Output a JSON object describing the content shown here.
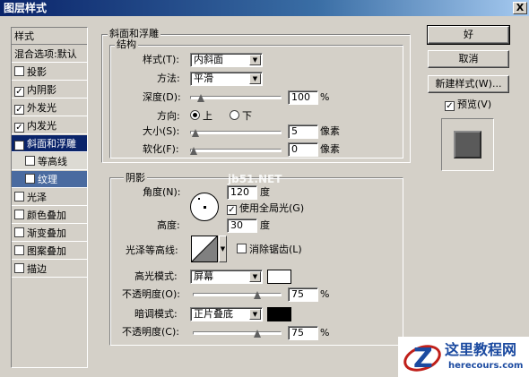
{
  "window": {
    "title": "图层样式",
    "close": "X"
  },
  "left_panel": {
    "items": [
      {
        "label": "样式",
        "checkbox": false
      },
      {
        "label": "混合选项:默认",
        "checkbox": false
      },
      {
        "label": "投影",
        "checkbox": true,
        "checked": false
      },
      {
        "label": "内阴影",
        "checkbox": true,
        "checked": true
      },
      {
        "label": "外发光",
        "checkbox": true,
        "checked": true
      },
      {
        "label": "内发光",
        "checkbox": true,
        "checked": true
      },
      {
        "label": "斜面和浮雕",
        "checkbox": true,
        "checked": true,
        "selected": true
      },
      {
        "label": "等高线",
        "checkbox": true,
        "checked": false,
        "sub": true
      },
      {
        "label": "纹理",
        "checkbox": true,
        "checked": false,
        "sub": true,
        "subsel": true
      },
      {
        "label": "光泽",
        "checkbox": true,
        "checked": false
      },
      {
        "label": "颜色叠加",
        "checkbox": true,
        "checked": false
      },
      {
        "label": "渐变叠加",
        "checkbox": true,
        "checked": false
      },
      {
        "label": "图案叠加",
        "checkbox": true,
        "checked": false
      },
      {
        "label": "描边",
        "checkbox": true,
        "checked": false
      }
    ]
  },
  "bevel": {
    "group_title": "斜面和浮雕",
    "structure_title": "结构",
    "style_label": "样式(T):",
    "style_value": "内斜面",
    "technique_label": "方法:",
    "technique_value": "平滑",
    "depth_label": "深度(D):",
    "depth_value": "100",
    "depth_unit": "%",
    "depth_level": 0.08,
    "direction_label": "方向:",
    "direction_up": "上",
    "direction_down": "下",
    "size_label": "大小(S):",
    "size_value": "5",
    "size_unit": "像素",
    "size_level": 0.02,
    "soften_label": "软化(F):",
    "soften_value": "0",
    "soften_unit": "像素",
    "soften_level": 0.0
  },
  "shading": {
    "title": "阴影",
    "angle_label": "角度(N):",
    "angle_value": "120",
    "angle_unit": "度",
    "global_light_label": "使用全局光(G)",
    "altitude_label": "高度:",
    "altitude_value": "30",
    "altitude_unit": "度",
    "gloss_label": "光泽等高线:",
    "anti_alias_label": "消除锯齿(L)",
    "highlight_mode_label": "高光模式:",
    "highlight_mode_value": "屏幕",
    "highlight_color": "#ffffff",
    "highlight_opacity_label": "不透明度(O):",
    "highlight_opacity_value": "75",
    "highlight_opacity_unit": "%",
    "highlight_opacity_level": 0.75,
    "shadow_mode_label": "暗调模式:",
    "shadow_mode_value": "正片叠底",
    "shadow_color": "#000000",
    "shadow_opacity_label": "不透明度(C):",
    "shadow_opacity_value": "75",
    "shadow_opacity_unit": "%",
    "shadow_opacity_level": 0.75
  },
  "buttons": {
    "ok": "好",
    "cancel": "取消",
    "new_style": "新建样式(W)...",
    "preview": "预览(V)"
  },
  "watermark": "jb51.NET",
  "logo": {
    "title": "这里教程网",
    "url": "herecours.com"
  }
}
